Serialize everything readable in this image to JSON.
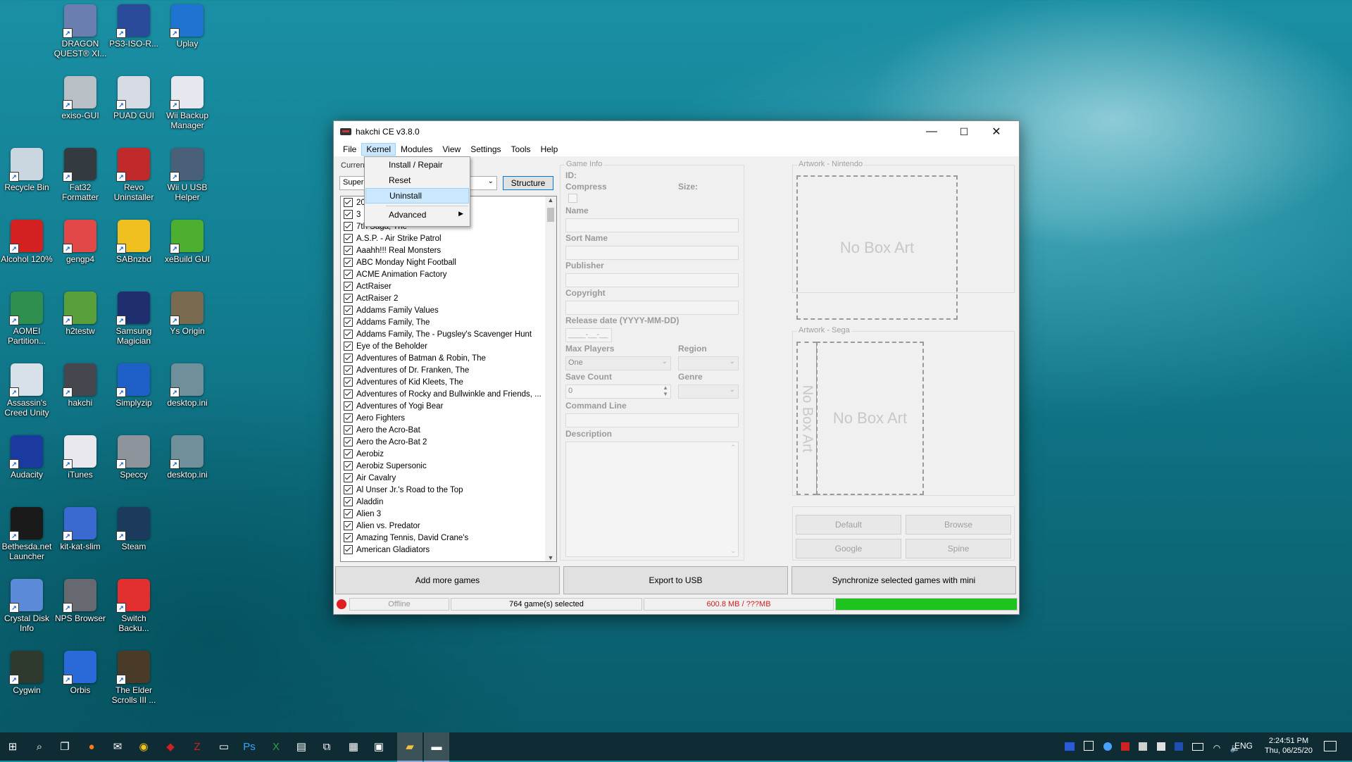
{
  "desktop": {
    "icons": [
      {
        "label": "DRAGON QUEST® XI...",
        "icon": "dragon-quest-icon",
        "color": "#6a7fb0"
      },
      {
        "label": "PS3-ISO-R...",
        "icon": "disc-icon",
        "color": "#2a4a9a"
      },
      {
        "label": "Uplay",
        "icon": "uplay-icon",
        "color": "#1e74d0"
      },
      {
        "label": "exiso-GUI",
        "icon": "xbox-console-icon",
        "color": "#b8c0c6"
      },
      {
        "label": "PUAD GUI",
        "icon": "puad-icon",
        "color": "#d7dce4"
      },
      {
        "label": "Wii Backup Manager",
        "icon": "wii-backup-icon",
        "color": "#e5e8ee"
      },
      {
        "label": "Recycle Bin",
        "icon": "recycle-bin-icon",
        "color": "#cbd7e0"
      },
      {
        "label": "Fat32 Formatter",
        "icon": "fat32-formatter-icon",
        "color": "#333a40"
      },
      {
        "label": "Revo Uninstaller",
        "icon": "revo-uninstaller-icon",
        "color": "#c02a2a"
      },
      {
        "label": "Wii U USB Helper",
        "icon": "rocket-icon",
        "color": "#4a6078"
      },
      {
        "label": "Alcohol 120%",
        "icon": "alcohol-icon",
        "color": "#d42020"
      },
      {
        "label": "gengp4",
        "icon": "download-icon",
        "color": "#e34848"
      },
      {
        "label": "SABnzbd",
        "icon": "sabnzbd-icon",
        "color": "#f0c020"
      },
      {
        "label": "xeBuild GUI",
        "icon": "xbox-icon",
        "color": "#4caf30"
      },
      {
        "label": "AOMEI Partition...",
        "icon": "aomei-icon",
        "color": "#2f8f4f"
      },
      {
        "label": "h2testw",
        "icon": "checkmark-icon",
        "color": "#5aa03a"
      },
      {
        "label": "Samsung Magician",
        "icon": "samsung-magician-icon",
        "color": "#1e2e6e"
      },
      {
        "label": "Ys Origin",
        "icon": "ys-origin-icon",
        "color": "#7a6a50"
      },
      {
        "label": "Assassin's Creed Unity",
        "icon": "assassins-creed-icon",
        "color": "#d8e0ea"
      },
      {
        "label": "hakchi",
        "icon": "snes-console-icon",
        "color": "#44484e"
      },
      {
        "label": "Simplyzip",
        "icon": "zip-icon",
        "color": "#1e60c8"
      },
      {
        "label": "desktop.ini",
        "icon": "settings-file-icon",
        "color": "#6f8f9a"
      },
      {
        "label": "Audacity",
        "icon": "headphones-icon",
        "color": "#1a3aa0"
      },
      {
        "label": "iTunes",
        "icon": "music-note-icon",
        "color": "#e8e8ee"
      },
      {
        "label": "Speccy",
        "icon": "pc-tower-icon",
        "color": "#8d949c"
      },
      {
        "label": "desktop.ini",
        "icon": "settings-file-icon",
        "color": "#6f8f9a"
      },
      {
        "label": "Bethesda.net Launcher",
        "icon": "bethesda-icon",
        "color": "#1a1a1a"
      },
      {
        "label": "kit-kat-slim",
        "icon": "kit-kat-slim-icon",
        "color": "#3a6ad0"
      },
      {
        "label": "Steam",
        "icon": "steam-icon",
        "color": "#1b3a5c"
      },
      {
        "label": "Crystal Disk Info",
        "icon": "crystal-disk-icon",
        "color": "#5a8ad8"
      },
      {
        "label": "NPS Browser",
        "icon": "nps-browser-icon",
        "color": "#666a70"
      },
      {
        "label": "Switch Backu...",
        "icon": "switch-icon",
        "color": "#e23030"
      },
      {
        "label": "Cygwin",
        "icon": "cygwin-icon",
        "color": "#2f3a2f"
      },
      {
        "label": "Orbis",
        "icon": "orbis-icon",
        "color": "#2a6ad8"
      },
      {
        "label": "The Elder Scrolls III ...",
        "icon": "elder-scrolls-icon",
        "color": "#4a3a28"
      }
    ]
  },
  "window": {
    "title": "hakchi CE v3.8.0",
    "controls": {
      "minimize": "—",
      "maximize": "☐",
      "close": "✕"
    }
  },
  "menu": {
    "items": [
      "File",
      "Kernel",
      "Modules",
      "View",
      "Settings",
      "Tools",
      "Help"
    ],
    "open": "Kernel"
  },
  "kernel_menu": {
    "items": [
      "Install / Repair",
      "Reset",
      "Uninstall"
    ],
    "highlighted": "Uninstall",
    "advanced": "Advanced"
  },
  "left": {
    "current_label": "Curren",
    "combo_value": "Super",
    "structure_button": "Structure"
  },
  "games": [
    "20",
    "3",
    "7th Saga, The",
    "A.S.P. - Air Strike Patrol",
    "Aaahh!!! Real Monsters",
    "ABC Monday Night Football",
    "ACME Animation Factory",
    "ActRaiser",
    "ActRaiser 2",
    "Addams Family Values",
    "Addams Family, The",
    "Addams Family, The - Pugsley's Scavenger Hunt",
    "Eye of the Beholder",
    "Adventures of Batman & Robin, The",
    "Adventures of Dr. Franken, The",
    "Adventures of Kid Kleets, The",
    "Adventures of Rocky and Bullwinkle and Friends, ...",
    "Adventures of Yogi Bear",
    "Aero Fighters",
    "Aero the Acro-Bat",
    "Aero the Acro-Bat 2",
    "Aerobiz",
    "Aerobiz Supersonic",
    "Air Cavalry",
    "Al Unser Jr.'s Road to the Top",
    "Aladdin",
    "Alien 3",
    "Alien vs. Predator",
    "Amazing Tennis, David Crane's",
    "American Gladiators"
  ],
  "game_info": {
    "group": "Game Info",
    "id": "ID:",
    "compress": "Compress",
    "size": "Size:",
    "name": "Name",
    "sort_name": "Sort Name",
    "publisher": "Publisher",
    "copyright": "Copyright",
    "release_date": "Release date (YYYY-MM-DD)",
    "release_value": "____-__-__",
    "max_players": "Max Players",
    "max_players_value": "One",
    "region": "Region",
    "save_count": "Save Count",
    "save_count_value": "0",
    "genre": "Genre",
    "command_line": "Command Line",
    "description": "Description"
  },
  "artwork": {
    "nintendo_group": "Artwork - Nintendo",
    "sega_group": "Artwork - Sega",
    "no_box_art": "No Box Art",
    "buttons": [
      "Default",
      "Browse",
      "Google",
      "Spine"
    ]
  },
  "actions": {
    "add": "Add more games",
    "export": "Export to USB",
    "sync": "Synchronize selected games with mini"
  },
  "status": {
    "connection": "Offline",
    "selected": "764 game(s) selected",
    "size": "600.8 MB / ???MB",
    "size_color": "#d02020",
    "progress": 1.0,
    "indicator_color": "#e02020",
    "progress_color": "#1ec31e"
  },
  "taskbar": {
    "icons": [
      "windows-start-icon",
      "search-icon",
      "task-view-icon",
      "firefox-icon",
      "outlook-icon",
      "chrome-icon",
      "app-icon",
      "filezilla-icon",
      "monitor-icon",
      "photoshop-icon",
      "excel-icon",
      "terminal-icon",
      "network-icon",
      "calculator-icon",
      "remote-icon",
      "file-explorer-icon",
      "hakchi-taskbar-icon"
    ],
    "language": "ENG",
    "time": "2:24:51 PM",
    "date": "Thu, 06/25/20"
  }
}
